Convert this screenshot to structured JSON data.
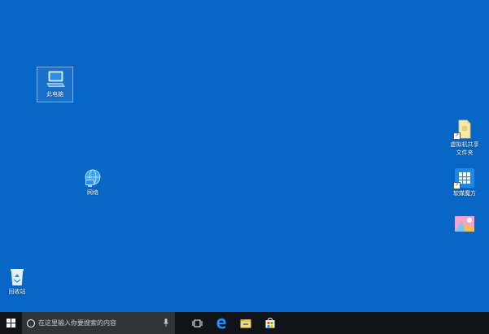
{
  "desktop": {
    "background": "#0867c6",
    "icons": [
      {
        "label": "此电脑",
        "icon": "computer-icon"
      },
      {
        "label": "网络",
        "icon": "network-icon"
      },
      {
        "label": "回收站",
        "icon": "recycle-bin-icon"
      },
      {
        "label": "虚拟机共享文件夹",
        "icon": "shared-folder-icon",
        "shortcut": true
      },
      {
        "label": "软媒魔方",
        "icon": "app-tile-icon",
        "shortcut": true
      },
      {
        "label": "",
        "icon": "colorful-app-icon",
        "shortcut": false
      }
    ]
  },
  "taskbar": {
    "background": "#101418",
    "search": {
      "placeholder": "在这里输入你要搜索的内容"
    },
    "buttons": [
      "start-icon",
      "task-view-icon",
      "edge-icon",
      "file-explorer-icon",
      "store-icon"
    ]
  }
}
